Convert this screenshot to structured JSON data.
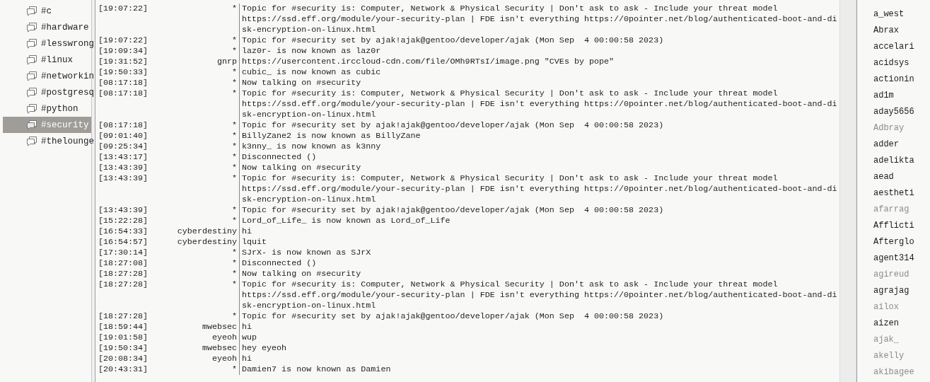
{
  "channels": [
    {
      "name": "#c",
      "selected": false
    },
    {
      "name": "#hardware",
      "selected": false
    },
    {
      "name": "#lesswrong",
      "selected": false
    },
    {
      "name": "#linux",
      "selected": false
    },
    {
      "name": "#networkin",
      "selected": false
    },
    {
      "name": "#postgresq",
      "selected": false
    },
    {
      "name": "#python",
      "selected": false
    },
    {
      "name": "#security",
      "selected": true
    },
    {
      "name": "#thelounge",
      "selected": false
    }
  ],
  "messages": [
    {
      "time": "[19:07:22]",
      "nick": "*",
      "lines": [
        "Topic for #security is: Computer, Network & Physical Security | Don't ask to ask - Include your threat model",
        "https://ssd.eff.org/module/your-security-plan | FDE isn't everything https://0pointer.net/blog/authenticated-boot-and-di",
        "sk-encryption-on-linux.html"
      ]
    },
    {
      "time": "[19:07:22]",
      "nick": "*",
      "lines": [
        "Topic for #security set by ajak!ajak@gentoo/developer/ajak (Mon Sep  4 00:00:58 2023)"
      ]
    },
    {
      "time": "[19:09:34]",
      "nick": "*",
      "lines": [
        "laz0r- is now known as laz0r"
      ]
    },
    {
      "time": "[19:31:52]",
      "nick": "gnrp",
      "lines": [
        "https://usercontent.irccloud-cdn.com/file/OMh9RTsI/image.png \"CVEs by pope\""
      ]
    },
    {
      "time": "[19:50:33]",
      "nick": "*",
      "lines": [
        "cubic_ is now known as cubic"
      ]
    },
    {
      "time": "[08:17:18]",
      "nick": "*",
      "lines": [
        "Now talking on #security"
      ]
    },
    {
      "time": "[08:17:18]",
      "nick": "*",
      "lines": [
        "Topic for #security is: Computer, Network & Physical Security | Don't ask to ask - Include your threat model",
        "https://ssd.eff.org/module/your-security-plan | FDE isn't everything https://0pointer.net/blog/authenticated-boot-and-di",
        "sk-encryption-on-linux.html"
      ]
    },
    {
      "time": "[08:17:18]",
      "nick": "*",
      "lines": [
        "Topic for #security set by ajak!ajak@gentoo/developer/ajak (Mon Sep  4 00:00:58 2023)"
      ]
    },
    {
      "time": "[09:01:40]",
      "nick": "*",
      "lines": [
        "BillyZane2 is now known as BillyZane"
      ]
    },
    {
      "time": "[09:25:34]",
      "nick": "*",
      "lines": [
        "k3nny_ is now known as k3nny"
      ]
    },
    {
      "time": "[13:43:17]",
      "nick": "*",
      "lines": [
        "Disconnected ()"
      ]
    },
    {
      "time": "[13:43:39]",
      "nick": "*",
      "lines": [
        "Now talking on #security"
      ]
    },
    {
      "time": "[13:43:39]",
      "nick": "*",
      "lines": [
        "Topic for #security is: Computer, Network & Physical Security | Don't ask to ask - Include your threat model",
        "https://ssd.eff.org/module/your-security-plan | FDE isn't everything https://0pointer.net/blog/authenticated-boot-and-di",
        "sk-encryption-on-linux.html"
      ]
    },
    {
      "time": "[13:43:39]",
      "nick": "*",
      "lines": [
        "Topic for #security set by ajak!ajak@gentoo/developer/ajak (Mon Sep  4 00:00:58 2023)"
      ]
    },
    {
      "time": "[15:22:28]",
      "nick": "*",
      "lines": [
        "Lord_of_Life_ is now known as Lord_of_Life"
      ]
    },
    {
      "time": "[16:54:33]",
      "nick": "cyberdestiny",
      "lines": [
        "hi"
      ]
    },
    {
      "time": "[16:54:57]",
      "nick": "cyberdestiny",
      "lines": [
        "lquit"
      ]
    },
    {
      "time": "[17:30:14]",
      "nick": "*",
      "lines": [
        "SJrX- is now known as SJrX"
      ]
    },
    {
      "time": "[18:27:08]",
      "nick": "*",
      "lines": [
        "Disconnected ()"
      ]
    },
    {
      "time": "[18:27:28]",
      "nick": "*",
      "lines": [
        "Now talking on #security"
      ]
    },
    {
      "time": "[18:27:28]",
      "nick": "*",
      "lines": [
        "Topic for #security is: Computer, Network & Physical Security | Don't ask to ask - Include your threat model",
        "https://ssd.eff.org/module/your-security-plan | FDE isn't everything https://0pointer.net/blog/authenticated-boot-and-di",
        "sk-encryption-on-linux.html"
      ]
    },
    {
      "time": "[18:27:28]",
      "nick": "*",
      "lines": [
        "Topic for #security set by ajak!ajak@gentoo/developer/ajak (Mon Sep  4 00:00:58 2023)"
      ]
    },
    {
      "time": "[18:59:44]",
      "nick": "mwebsec",
      "lines": [
        "hi"
      ]
    },
    {
      "time": "[19:01:58]",
      "nick": "eyeoh",
      "lines": [
        "wup"
      ]
    },
    {
      "time": "[19:50:34]",
      "nick": "mwebsec",
      "lines": [
        "hey eyeoh"
      ]
    },
    {
      "time": "[20:08:34]",
      "nick": "eyeoh",
      "lines": [
        "hi"
      ]
    },
    {
      "time": "[20:43:31]",
      "nick": "*",
      "lines": [
        "Damien7 is now known as Damien"
      ]
    }
  ],
  "users": [
    {
      "name": "a_west",
      "away": false
    },
    {
      "name": "Abrax",
      "away": false
    },
    {
      "name": "accelari",
      "away": false
    },
    {
      "name": "acidsys",
      "away": false
    },
    {
      "name": "actionin",
      "away": false
    },
    {
      "name": "ad1m",
      "away": false
    },
    {
      "name": "aday5656",
      "away": false
    },
    {
      "name": "Adbray",
      "away": true
    },
    {
      "name": "adder",
      "away": false
    },
    {
      "name": "adelikta",
      "away": false
    },
    {
      "name": "aead",
      "away": false
    },
    {
      "name": "aestheti",
      "away": false
    },
    {
      "name": "afarrag",
      "away": true
    },
    {
      "name": "Afflicti",
      "away": false
    },
    {
      "name": "Afterglo",
      "away": false
    },
    {
      "name": "agent314",
      "away": false
    },
    {
      "name": "agireud",
      "away": true
    },
    {
      "name": "agrajag",
      "away": false
    },
    {
      "name": "ailox",
      "away": true
    },
    {
      "name": "aizen",
      "away": false
    },
    {
      "name": "ajak_",
      "away": true
    },
    {
      "name": "akelly",
      "away": true
    },
    {
      "name": "akibagee",
      "away": true
    }
  ]
}
